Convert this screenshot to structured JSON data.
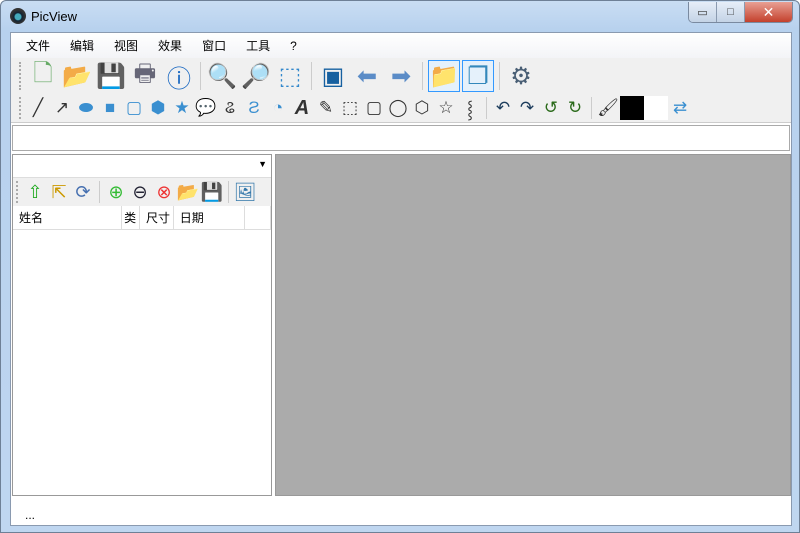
{
  "window": {
    "title": "PicView",
    "controls": {
      "minimize": "▭",
      "maximize": "□",
      "close": "✕"
    }
  },
  "menu": [
    "文件",
    "编辑",
    "视图",
    "效果",
    "窗口",
    "工具",
    "?"
  ],
  "toolbar_main": [
    {
      "icon": "new-file-icon",
      "glyph": "🗋",
      "color": "#6a6"
    },
    {
      "icon": "open-folder-icon",
      "glyph": "📂",
      "color": "#d90"
    },
    {
      "icon": "save-icon",
      "glyph": "💾",
      "color": "#1a7fc4"
    },
    {
      "icon": "print-icon",
      "glyph": "🖶",
      "color": "#667"
    },
    {
      "icon": "info-icon",
      "glyph": "ⓘ",
      "color": "#1565c0"
    },
    {
      "icon": "zoom-in-icon",
      "glyph": "🔍",
      "color": "#368"
    },
    {
      "icon": "zoom-out-icon",
      "glyph": "🔎",
      "color": "#368"
    },
    {
      "icon": "fit-page-icon",
      "glyph": "⬚",
      "color": "#38c"
    },
    {
      "icon": "easel-icon",
      "glyph": "▣",
      "color": "#1660a0"
    },
    {
      "icon": "arrow-left-icon",
      "glyph": "⬅",
      "color": "#5b8cc7"
    },
    {
      "icon": "arrow-right-icon",
      "glyph": "➡",
      "color": "#5b8cc7"
    },
    {
      "icon": "folder-icon",
      "glyph": "📁",
      "color": "#f5c400"
    },
    {
      "icon": "windows-cascade-icon",
      "glyph": "❐",
      "color": "#38b"
    },
    {
      "icon": "settings-gear-icon",
      "glyph": "⚙",
      "color": "#4a5f75"
    }
  ],
  "toolbar_draw": [
    {
      "icon": "line-icon",
      "glyph": "╱"
    },
    {
      "icon": "arrow-line-icon",
      "glyph": "↗"
    },
    {
      "icon": "ellipse-icon",
      "glyph": "⬬"
    },
    {
      "icon": "rectangle-icon",
      "glyph": "■"
    },
    {
      "icon": "rounded-rect-icon",
      "glyph": "▢"
    },
    {
      "icon": "hexagon-icon",
      "glyph": "⬢"
    },
    {
      "icon": "star-icon",
      "glyph": "★"
    },
    {
      "icon": "speech-bubble-icon",
      "glyph": "💬"
    },
    {
      "icon": "freehand-icon",
      "glyph": "ଌ"
    },
    {
      "icon": "free-shape-icon",
      "glyph": "Ƨ"
    },
    {
      "icon": "fill-bucket-icon",
      "glyph": "◔"
    },
    {
      "icon": "text-icon",
      "glyph": "A"
    },
    {
      "icon": "eyedropper-icon",
      "glyph": "✎"
    },
    {
      "icon": "select-rect-icon",
      "glyph": "⬚"
    },
    {
      "icon": "select-rounded-icon",
      "glyph": "▢"
    },
    {
      "icon": "select-ellipse-icon",
      "glyph": "◯"
    },
    {
      "icon": "select-hexagon-icon",
      "glyph": "⬡"
    },
    {
      "icon": "select-star-icon",
      "glyph": "☆"
    },
    {
      "icon": "select-free-icon",
      "glyph": "⸾"
    },
    {
      "icon": "undo-icon",
      "glyph": "↶"
    },
    {
      "icon": "redo-icon",
      "glyph": "↷"
    },
    {
      "icon": "rotate-left-icon",
      "glyph": "↺"
    },
    {
      "icon": "rotate-right-icon",
      "glyph": "↻"
    },
    {
      "icon": "brush-icon",
      "glyph": "🖌"
    }
  ],
  "colors": {
    "foreground": "#000000",
    "background": "#ffffff",
    "view_bg": "#ababab",
    "accent": "#3399ff"
  },
  "left_toolbar": [
    {
      "icon": "folder-up-icon",
      "glyph": "⇧",
      "color": "#2a2"
    },
    {
      "icon": "folder-select-icon",
      "glyph": "⇱",
      "color": "#c90"
    },
    {
      "icon": "refresh-icon",
      "glyph": "⟳",
      "color": "#4670b0"
    },
    {
      "icon": "add-icon",
      "glyph": "⊕",
      "color": "#3b3"
    },
    {
      "icon": "remove-icon",
      "glyph": "⊖",
      "color": "#223"
    },
    {
      "icon": "delete-icon",
      "glyph": "⊗",
      "color": "#e33"
    },
    {
      "icon": "open-file-icon",
      "glyph": "📂",
      "color": "#d90"
    },
    {
      "icon": "save-download-icon",
      "glyph": "💾",
      "color": "#18a"
    },
    {
      "icon": "images-icon",
      "glyph": "🖼",
      "color": "#37a"
    }
  ],
  "list_columns": [
    "姓名",
    "类",
    "尺寸",
    "日期"
  ],
  "status": "..."
}
